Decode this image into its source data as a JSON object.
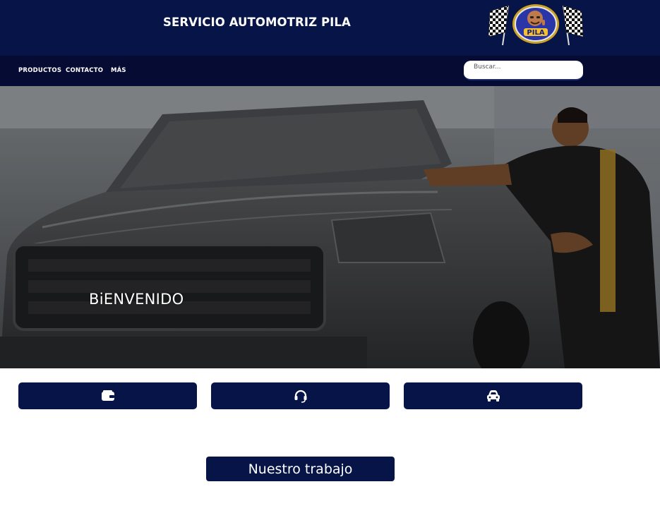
{
  "header": {
    "site_title": "SERVICIO AUTOMOTRIZ PILA",
    "logo_text": "PILA",
    "background": "#071447"
  },
  "nav": {
    "items": [
      {
        "label": "PRODUCTOS"
      },
      {
        "label": "CONTACTO"
      },
      {
        "label": "MÁS"
      }
    ],
    "background": "#060b33"
  },
  "search": {
    "placeholder": "Buscar..."
  },
  "hero": {
    "title": "BiENVENIDO"
  },
  "features": [
    {
      "icon": "wallet-icon"
    },
    {
      "icon": "headset-icon"
    },
    {
      "icon": "car-icon"
    }
  ],
  "section": {
    "title": "Nuestro trabajo"
  },
  "colors": {
    "accent": "#071447",
    "white": "#ffffff"
  }
}
